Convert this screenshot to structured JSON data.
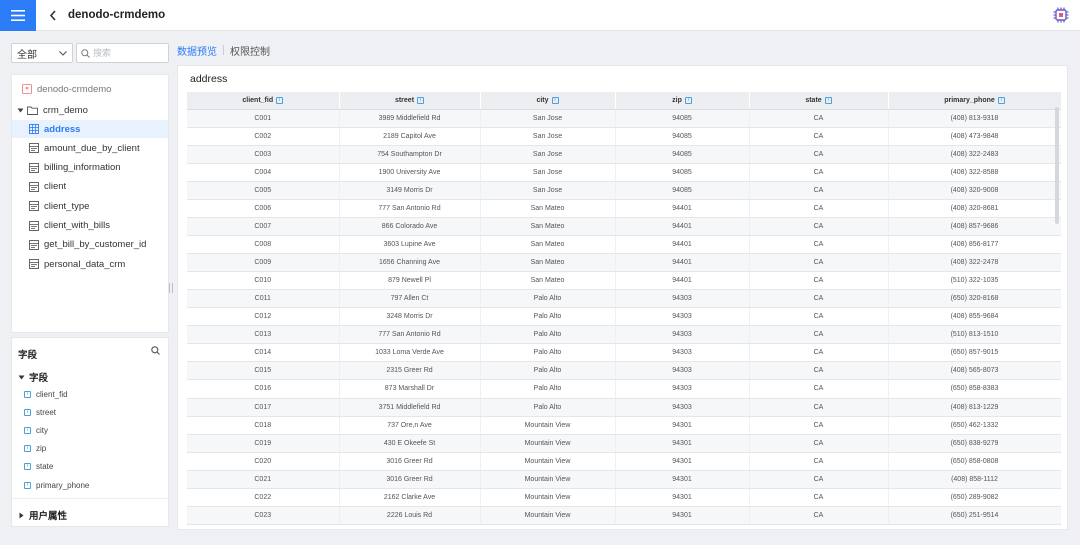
{
  "header": {
    "title": "denodo-crmdemo",
    "menu_icon": "hamburger-menu-icon",
    "back_icon": "chevron-left-icon",
    "app_icon": "database-chip-icon",
    "accent": "#2b7cf6"
  },
  "sidebar": {
    "filter_selected": "全部",
    "search_placeholder": "搜索",
    "root_label": "denodo-crmdemo",
    "folder_label": "crm_demo",
    "items": [
      {
        "label": "address",
        "type": "table",
        "selected": true
      },
      {
        "label": "amount_due_by_client",
        "type": "view",
        "selected": false
      },
      {
        "label": "billing_information",
        "type": "view",
        "selected": false
      },
      {
        "label": "client",
        "type": "view",
        "selected": false
      },
      {
        "label": "client_type",
        "type": "view",
        "selected": false
      },
      {
        "label": "client_with_bills",
        "type": "view",
        "selected": false
      },
      {
        "label": "get_bill_by_customer_id",
        "type": "view",
        "selected": false
      },
      {
        "label": "personal_data_crm",
        "type": "view",
        "selected": false
      }
    ]
  },
  "fields": {
    "heading": "字段",
    "group_label": "字段",
    "items": [
      "client_fid",
      "street",
      "city",
      "zip",
      "state",
      "primary_phone"
    ],
    "user_attr_label": "用户属性"
  },
  "tabs": [
    {
      "label": "数据预览",
      "active": true
    },
    {
      "label": "权限控制",
      "active": false
    }
  ],
  "main": {
    "title": "address",
    "columns": [
      "client_fid",
      "street",
      "city",
      "zip",
      "state",
      "primary_phone"
    ],
    "rows": [
      [
        "C001",
        "3989 Middlefield Rd",
        "San Jose",
        "94085",
        "CA",
        "(408) 813-9318"
      ],
      [
        "C002",
        "2189 Capitol Ave",
        "San Jose",
        "94085",
        "CA",
        "(408) 473-9848"
      ],
      [
        "C003",
        "754 Southampton Dr",
        "San Jose",
        "94085",
        "CA",
        "(408) 322-2483"
      ],
      [
        "C004",
        "1900 University Ave",
        "San Jose",
        "94085",
        "CA",
        "(408) 322-8588"
      ],
      [
        "C005",
        "3149 Morris Dr",
        "San Jose",
        "94085",
        "CA",
        "(408) 320-9008"
      ],
      [
        "C006",
        "777 San Antonio Rd",
        "San Mateo",
        "94401",
        "CA",
        "(408) 320-8681"
      ],
      [
        "C007",
        "866 Colorado Ave",
        "San Mateo",
        "94401",
        "CA",
        "(408) 857-9686"
      ],
      [
        "C008",
        "3603 Lupine Ave",
        "San Mateo",
        "94401",
        "CA",
        "(408) 856-8177"
      ],
      [
        "C009",
        "1656 Channing Ave",
        "San Mateo",
        "94401",
        "CA",
        "(408) 322-2478"
      ],
      [
        "C010",
        "879 Newell Pl",
        "San Mateo",
        "94401",
        "CA",
        "(510) 322-1035"
      ],
      [
        "C011",
        "797 Allen Ct",
        "Palo Alto",
        "94303",
        "CA",
        "(650) 320-8168"
      ],
      [
        "C012",
        "3248 Morris Dr",
        "Palo Alto",
        "94303",
        "CA",
        "(408) 855-9684"
      ],
      [
        "C013",
        "777 San Antonio Rd",
        "Palo Alto",
        "94303",
        "CA",
        "(510) 813-1510"
      ],
      [
        "C014",
        "1033 Loma Verde Ave",
        "Palo Alto",
        "94303",
        "CA",
        "(650) 857-9015"
      ],
      [
        "C015",
        "2315 Greer Rd",
        "Palo Alto",
        "94303",
        "CA",
        "(408) 565-8073"
      ],
      [
        "C016",
        "873 Marshall Dr",
        "Palo Alto",
        "94303",
        "CA",
        "(650) 858-8383"
      ],
      [
        "C017",
        "3751 Middlefield Rd",
        "Palo Alto",
        "94303",
        "CA",
        "(408) 813-1229"
      ],
      [
        "C018",
        "737 Ore,n Ave",
        "Mountain View",
        "94301",
        "CA",
        "(650) 462-1332"
      ],
      [
        "C019",
        "430 E Okeefe St",
        "Mountain View",
        "94301",
        "CA",
        "(650) 838-9279"
      ],
      [
        "C020",
        "3016 Greer Rd",
        "Mountain View",
        "94301",
        "CA",
        "(650) 858-0808"
      ],
      [
        "C021",
        "3016 Greer Rd",
        "Mountain View",
        "94301",
        "CA",
        "(408) 858-1112"
      ],
      [
        "C022",
        "2162 Clarke Ave",
        "Mountain View",
        "94301",
        "CA",
        "(650) 289-9082"
      ],
      [
        "C023",
        "2226 Louis Rd",
        "Mountain View",
        "94301",
        "CA",
        "(650) 251-9514"
      ]
    ]
  }
}
